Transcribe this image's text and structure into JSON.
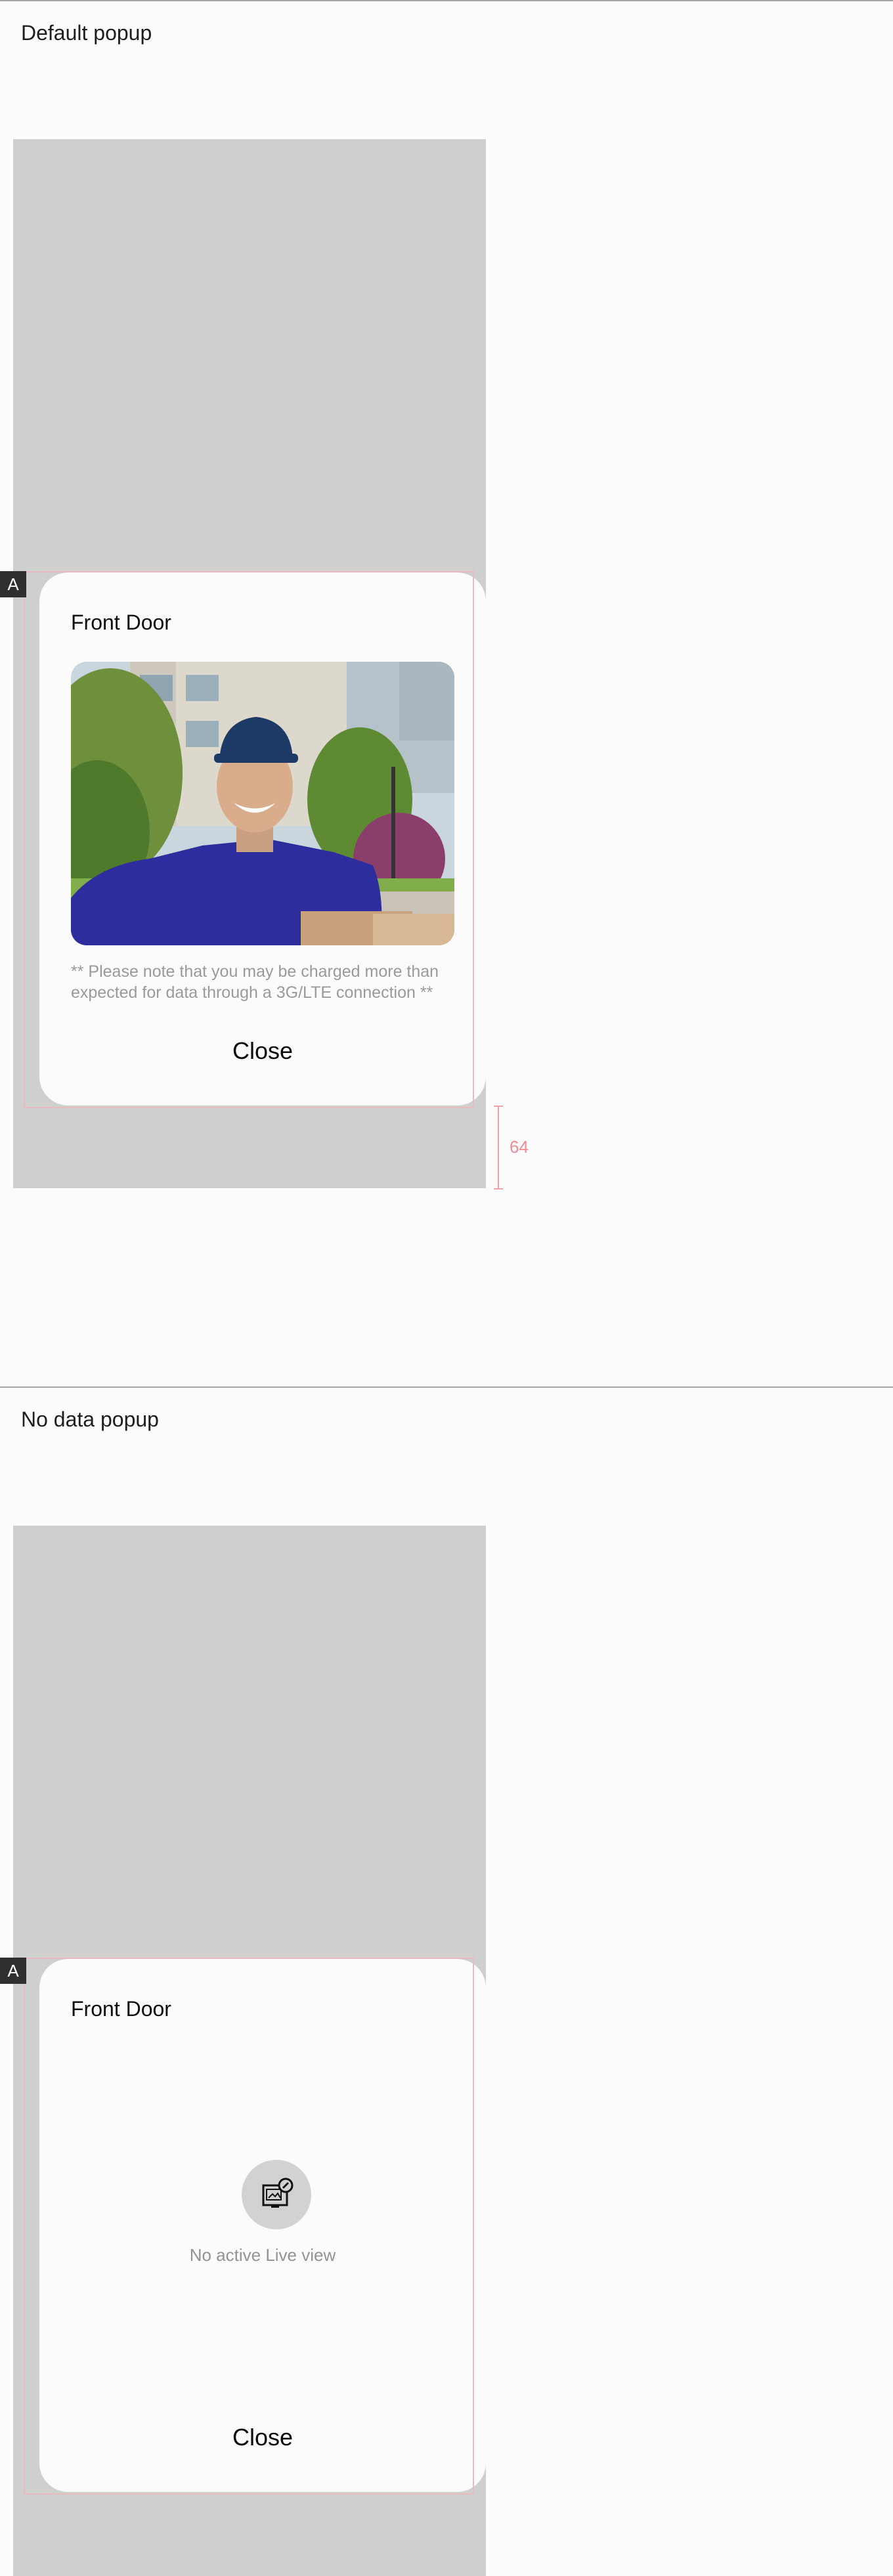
{
  "sections": [
    {
      "title": "Default popup",
      "badge": "A",
      "popup": {
        "title": "Front Door",
        "note": "** Please note that you may be charged more than expected for data through a 3G/LTE connection **",
        "close_label": "Close"
      },
      "spacing_label": "64"
    },
    {
      "title": "No data popup",
      "badge": "A",
      "popup": {
        "title": "Front Door",
        "empty_icon": "no-live-view-icon",
        "empty_message": "No active Live view",
        "close_label": "Close"
      }
    }
  ],
  "colors": {
    "background": "#fdfcfc",
    "phone_overlay": "#d0cfcf",
    "popup_bg": "#fbfbfb",
    "measure_accent": "#ee8a92",
    "muted_text": "#9a9a9a"
  }
}
